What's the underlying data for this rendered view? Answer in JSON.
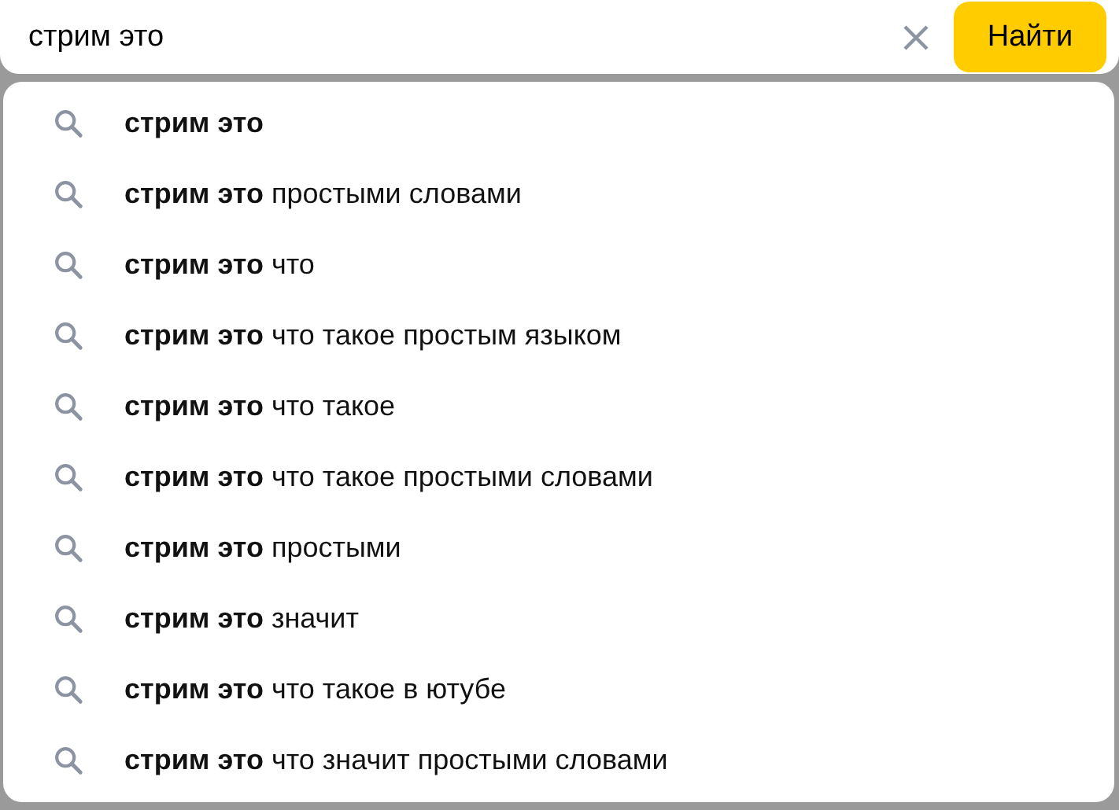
{
  "search": {
    "value": "стрим это",
    "button": "Найти"
  },
  "suggestions": [
    {
      "text": "**стрим это**"
    },
    {
      "text": "**стрим это** простыми словами"
    },
    {
      "text": "**стрим это** что"
    },
    {
      "text": "**стрим это** что такое простым языком"
    },
    {
      "text": "**стрим это** что такое"
    },
    {
      "text": "**стрим это** что такое простыми словами"
    },
    {
      "text": "**стрим это** простыми"
    },
    {
      "text": "**стрим это** значит"
    },
    {
      "text": "**стрим это** что такое в ютубе"
    },
    {
      "text": "**стрим это** что значит простыми словами"
    }
  ]
}
